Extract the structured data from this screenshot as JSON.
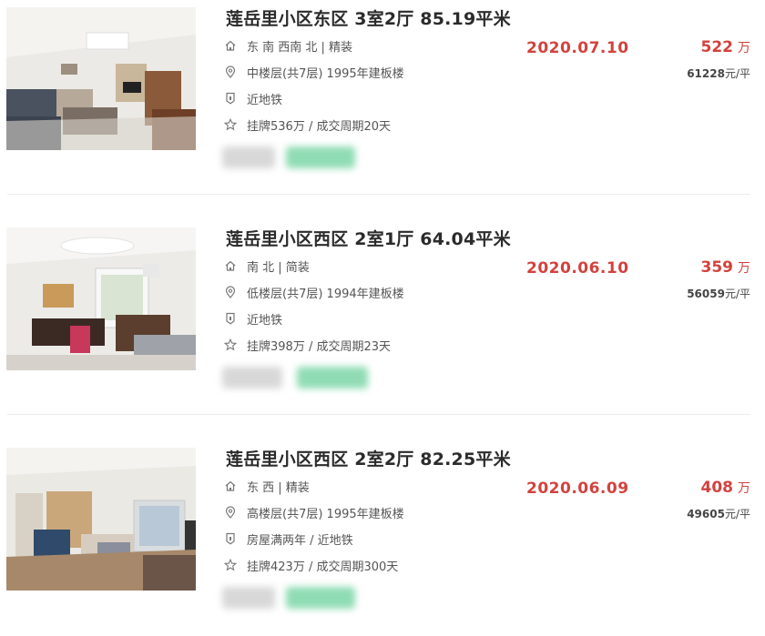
{
  "listings": [
    {
      "title": "莲岳里小区东区 3室2厅 85.19平米",
      "house_info": "东 南 西南 北 | 精装",
      "position_info": "中楼层(共7层) 1995年建板楼",
      "tags": "近地铁",
      "follow_info": "挂牌536万 / 成交周期20天",
      "deal_date": "2020.07.10",
      "total_price": "522",
      "price_unit": "万",
      "unit_price_num": "61228",
      "unit_price_suffix": "元/平"
    },
    {
      "title": "莲岳里小区西区 2室1厅 64.04平米",
      "house_info": "南 北 | 简装",
      "position_info": "低楼层(共7层) 1994年建板楼",
      "tags": "近地铁",
      "follow_info": "挂牌398万 / 成交周期23天",
      "deal_date": "2020.06.10",
      "total_price": "359",
      "price_unit": "万",
      "unit_price_num": "56059",
      "unit_price_suffix": "元/平"
    },
    {
      "title": "莲岳里小区西区 2室2厅 82.25平米",
      "house_info": "东 西 | 精装",
      "position_info": "高楼层(共7层) 1995年建板楼",
      "tags": "房屋满两年 / 近地铁",
      "follow_info": "挂牌423万 / 成交周期300天",
      "deal_date": "2020.06.09",
      "total_price": "408",
      "price_unit": "万",
      "unit_price_num": "49605",
      "unit_price_suffix": "元/平"
    }
  ],
  "icons": {
    "house": "house-icon",
    "location": "location-pin-icon",
    "tag": "shield-tag-icon",
    "follow": "star-icon"
  },
  "colors": {
    "accent_red": "#d2423d",
    "title": "#2b2b2b",
    "meta": "#555555"
  }
}
